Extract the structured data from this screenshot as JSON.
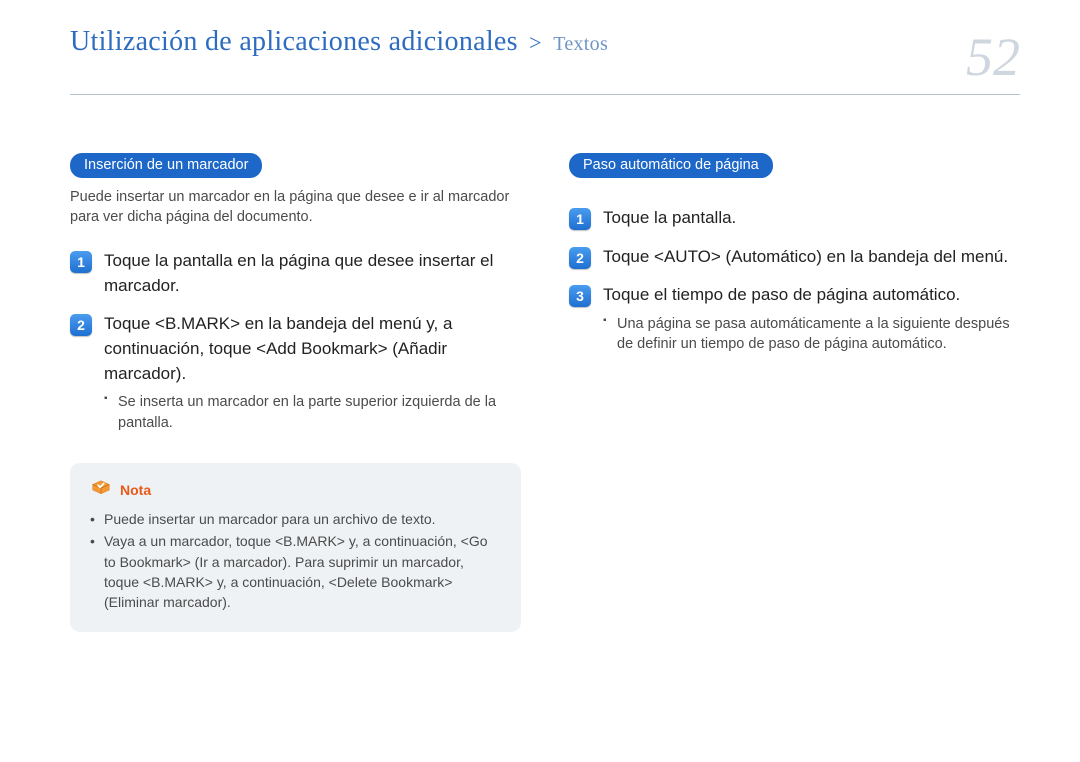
{
  "header": {
    "title_main": "Utilización de aplicaciones adicionales",
    "separator": ">",
    "title_sub": "Textos",
    "page_number": "52"
  },
  "left": {
    "section": "Inserción de un marcador",
    "intro": "Puede insertar un marcador en la página que desee e ir al marcador para ver dicha página del documento.",
    "steps": [
      {
        "n": "1",
        "text": "Toque la pantalla en la página que desee insertar el marcador."
      },
      {
        "n": "2",
        "text": "Toque <B.MARK> en la bandeja del menú y, a continuación, toque <Add Bookmark> (Añadir marcador).",
        "sub": [
          "Se inserta un marcador en la parte superior izquierda de la pantalla."
        ]
      }
    ],
    "note": {
      "label": "Nota",
      "items": [
        "Puede insertar un marcador para un archivo de texto.",
        "Vaya a un marcador, toque <B.MARK> y, a continuación, <Go to Bookmark> (Ir a marcador). Para suprimir un marcador, toque <B.MARK> y, a continuación, <Delete Bookmark> (Eliminar marcador)."
      ]
    }
  },
  "right": {
    "section": "Paso automático de página",
    "steps": [
      {
        "n": "1",
        "text": "Toque la pantalla."
      },
      {
        "n": "2",
        "text": "Toque <AUTO> (Automático) en la bandeja del menú."
      },
      {
        "n": "3",
        "text": "Toque el tiempo de paso de página automático.",
        "sub": [
          "Una página se pasa automáticamente a la siguiente después de definir un tiempo de paso de página automático."
        ]
      }
    ]
  }
}
